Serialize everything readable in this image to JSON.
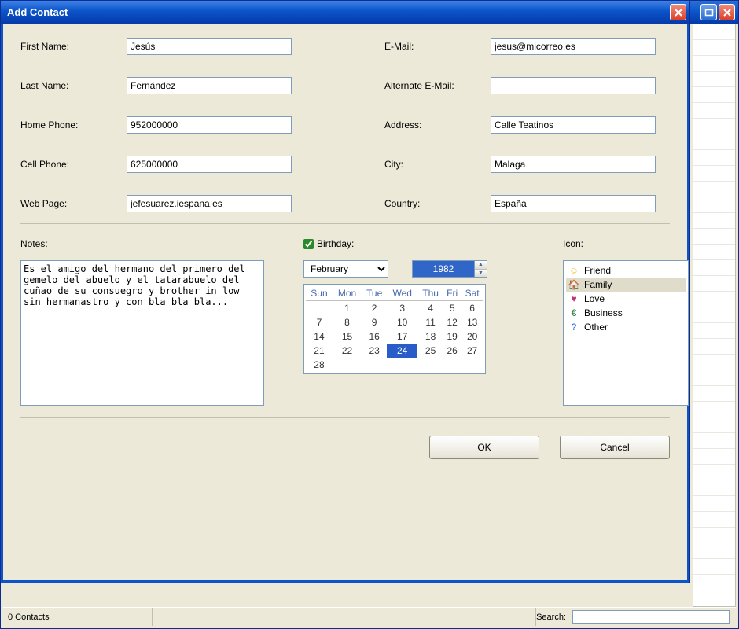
{
  "dialog": {
    "title": "Add Contact",
    "labels": {
      "first_name": "First Name:",
      "last_name": "Last Name:",
      "home_phone": "Home Phone:",
      "cell_phone": "Cell Phone:",
      "web_page": "Web Page:",
      "email": "E-Mail:",
      "alt_email": "Alternate E-Mail:",
      "address": "Address:",
      "city": "City:",
      "country": "Country:",
      "notes": "Notes:",
      "birthday": "Birthday:",
      "icon": "Icon:"
    },
    "values": {
      "first_name": "Jesús",
      "last_name": "Fernández",
      "home_phone": "952000000",
      "cell_phone": "625000000",
      "web_page": "jefesuarez.iespana.es",
      "email": "jesus@micorreo.es",
      "alt_email": "",
      "address": "Calle Teatinos",
      "city": "Malaga",
      "country": "España",
      "notes": "Es el amigo del hermano del primero del gemelo del abuelo y el tatarabuelo del cuñao de su consuegro y brother in low sin hermanastro y con bla bla bla..."
    },
    "birthday": {
      "checked": true,
      "month": "February",
      "year": "1982",
      "selected_day": 24,
      "weekdays": [
        "Sun",
        "Mon",
        "Tue",
        "Wed",
        "Thu",
        "Fri",
        "Sat"
      ],
      "days": [
        [
          "",
          "1",
          "2",
          "3",
          "4",
          "5",
          "6"
        ],
        [
          "7",
          "8",
          "9",
          "10",
          "11",
          "12",
          "13"
        ],
        [
          "14",
          "15",
          "16",
          "17",
          "18",
          "19",
          "20"
        ],
        [
          "21",
          "22",
          "23",
          "24",
          "25",
          "26",
          "27"
        ],
        [
          "28",
          "",
          "",
          "",
          "",
          "",
          ""
        ]
      ]
    },
    "icons": [
      {
        "key": "friend",
        "label": "Friend",
        "color": "#f0c040",
        "glyph": "☺"
      },
      {
        "key": "family",
        "label": "Family",
        "color": "#c04030",
        "glyph": "🏠",
        "selected": true
      },
      {
        "key": "love",
        "label": "Love",
        "color": "#c03070",
        "glyph": "♥"
      },
      {
        "key": "business",
        "label": "Business",
        "color": "#2a7a3a",
        "glyph": "€"
      },
      {
        "key": "other",
        "label": "Other",
        "color": "#2a6ad0",
        "glyph": "?"
      }
    ],
    "buttons": {
      "ok": "OK",
      "cancel": "Cancel"
    }
  },
  "statusbar": {
    "contacts": "0 Contacts",
    "search_label": "Search:",
    "search_value": ""
  }
}
